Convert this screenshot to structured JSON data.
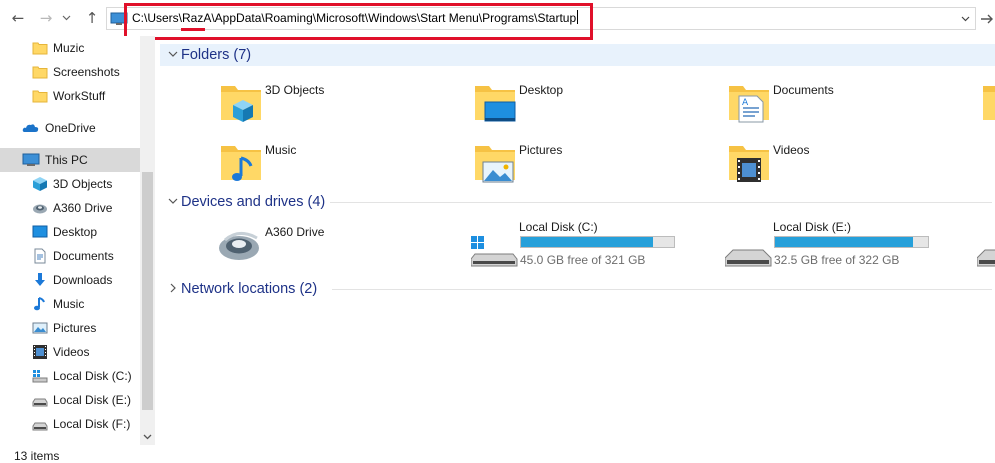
{
  "address": {
    "path": "C:\\Users\\RazA\\AppData\\Roaming\\Microsoft\\Windows\\Start Menu\\Programs\\Startup"
  },
  "sidebar": {
    "items": [
      {
        "label": "Muzic",
        "icon": "folder-icon"
      },
      {
        "label": "Screenshots",
        "icon": "folder-icon"
      },
      {
        "label": "WorkStuff",
        "icon": "folder-icon"
      },
      {
        "label": "OneDrive",
        "icon": "onedrive-icon"
      },
      {
        "label": "This PC",
        "icon": "this-pc-icon",
        "selected": true
      },
      {
        "label": "3D Objects",
        "icon": "3d-objects-icon"
      },
      {
        "label": "A360 Drive",
        "icon": "a360-drive-icon"
      },
      {
        "label": "Desktop",
        "icon": "desktop-icon"
      },
      {
        "label": "Documents",
        "icon": "documents-icon"
      },
      {
        "label": "Downloads",
        "icon": "downloads-icon"
      },
      {
        "label": "Music",
        "icon": "music-icon"
      },
      {
        "label": "Pictures",
        "icon": "pictures-icon"
      },
      {
        "label": "Videos",
        "icon": "videos-icon"
      },
      {
        "label": "Local Disk (C:)",
        "icon": "windows-drive-icon"
      },
      {
        "label": "Local Disk (E:)",
        "icon": "drive-icon"
      },
      {
        "label": "Local Disk (F:)",
        "icon": "drive-icon"
      }
    ]
  },
  "status": {
    "items_count": "13 items"
  },
  "groups": {
    "folders": {
      "title": "Folders (7)",
      "items": [
        {
          "label": "3D Objects"
        },
        {
          "label": "Desktop"
        },
        {
          "label": "Documents"
        },
        {
          "label": "Music"
        },
        {
          "label": "Pictures"
        },
        {
          "label": "Videos"
        }
      ]
    },
    "devices": {
      "title": "Devices and drives (4)",
      "items": [
        {
          "label": "A360 Drive"
        },
        {
          "label": "Local Disk (C:)",
          "free": "45.0 GB free of 321 GB",
          "used_fraction": 0.86
        },
        {
          "label": "Local Disk (E:)",
          "free": "32.5 GB free of 322 GB",
          "used_fraction": 0.9
        }
      ]
    },
    "network": {
      "title": "Network locations (2)"
    }
  },
  "colors": {
    "accent": "#26a0da",
    "header_text": "#1e3287",
    "highlight_box": "#e0102a",
    "folder": "#ffd866"
  }
}
